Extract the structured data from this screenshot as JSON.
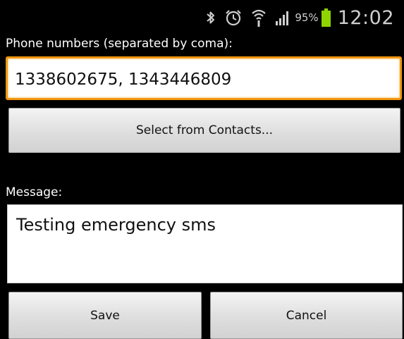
{
  "status_bar": {
    "icons": [
      "bluetooth-icon",
      "alarm-icon",
      "wifi-icon",
      "signal-icon",
      "battery-icon"
    ],
    "battery_percent": "95%",
    "time": "12:02",
    "battery_color": "#8fd400"
  },
  "form": {
    "phone_label": "Phone numbers (separated by coma):",
    "phone_value": "1338602675, 1343446809",
    "select_contacts_label": "Select from Contacts...",
    "message_label": "Message:",
    "message_value": "Testing emergency sms",
    "focus_color": "#f0960f"
  },
  "actions": {
    "save_label": "Save",
    "cancel_label": "Cancel"
  }
}
